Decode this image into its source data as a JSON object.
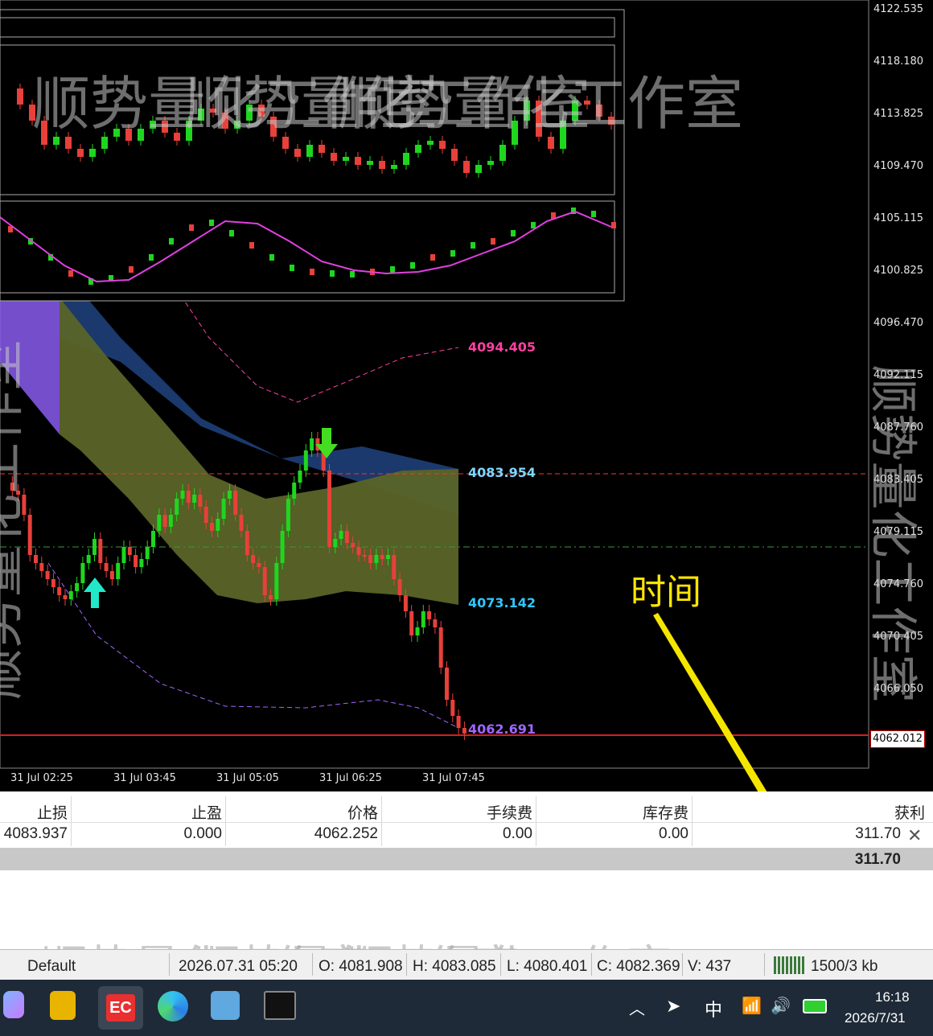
{
  "watermark_text": "顺势量化工作室",
  "price_axis": [
    "4122.535",
    "4118.180",
    "4113.825",
    "4109.470",
    "4105.115",
    "4100.825",
    "4096.470",
    "4092.115",
    "4087.760",
    "4083.405",
    "4079.115",
    "4074.760",
    "4070.405",
    "4066.050"
  ],
  "current_price": "4062.012",
  "time_axis": [
    "31 Jul 02:25",
    "31 Jul 03:45",
    "31 Jul 05:05",
    "31 Jul 06:25",
    "31 Jul 07:45"
  ],
  "levels": [
    {
      "value": "4094.405",
      "color": "#ff3fa0"
    },
    {
      "value": "4083.954",
      "color": "#7fd7ff"
    },
    {
      "value": "4073.142",
      "color": "#2fc8ff"
    },
    {
      "value": "4062.691",
      "color": "#a066ff"
    }
  ],
  "annotation": "时间",
  "trade_table": {
    "headers": [
      "止损",
      "止盈",
      "价格",
      "手续费",
      "库存费",
      "获利"
    ],
    "row": [
      "4083.937",
      "0.000",
      "4062.252",
      "0.00",
      "0.00",
      "311.70"
    ],
    "total": "311.70"
  },
  "status_bar": {
    "profile": "Default",
    "datetime": "2026.07.31 05:20",
    "open": "O: 4081.908",
    "high": "H: 4083.085",
    "low": "L: 4080.401",
    "close": "C: 4082.369",
    "volume": "V: 437",
    "connection": "1500/3 kb"
  },
  "taskbar": {
    "clock_time": "16:18",
    "clock_date": "2026/7/31",
    "ime": "中"
  },
  "colors": {
    "bull": "#1fd61f",
    "bear": "#e8403a",
    "blue_band": "#1e3f78",
    "olive_band": "#5a6428",
    "purple_band": "#8a5cf0"
  }
}
